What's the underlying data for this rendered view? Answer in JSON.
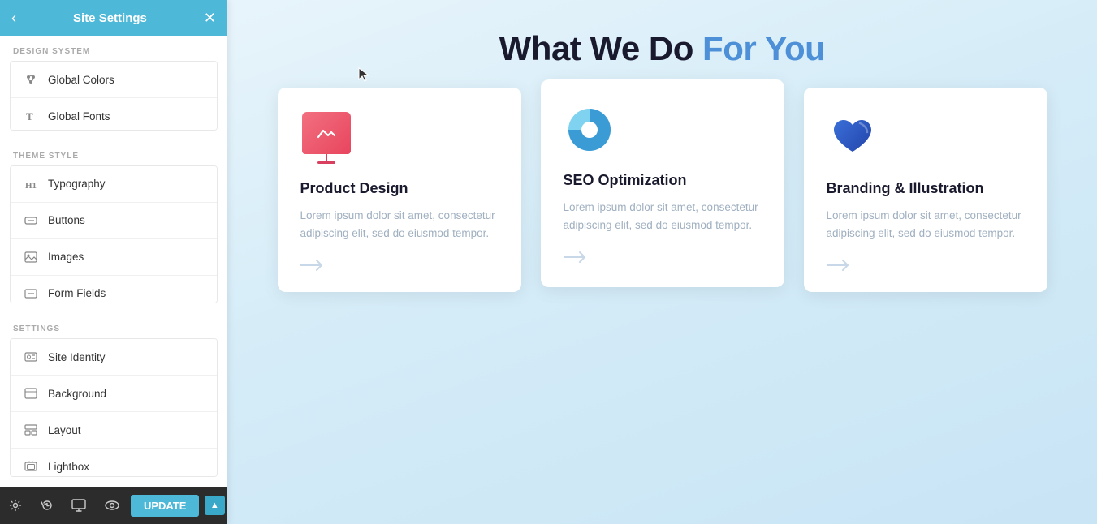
{
  "sidebar": {
    "title": "Site Settings",
    "back_label": "‹",
    "close_label": "✕",
    "sections": [
      {
        "label": "DESIGN SYSTEM",
        "items": [
          {
            "id": "global-colors",
            "label": "Global Colors",
            "icon": "palette"
          },
          {
            "id": "global-fonts",
            "label": "Global Fonts",
            "icon": "font"
          }
        ]
      },
      {
        "label": "THEME STYLE",
        "items": [
          {
            "id": "typography",
            "label": "Typography",
            "icon": "heading"
          },
          {
            "id": "buttons",
            "label": "Buttons",
            "icon": "button"
          },
          {
            "id": "images",
            "label": "Images",
            "icon": "image"
          },
          {
            "id": "form-fields",
            "label": "Form Fields",
            "icon": "form"
          }
        ]
      },
      {
        "label": "SETTINGS",
        "items": [
          {
            "id": "site-identity",
            "label": "Site Identity",
            "icon": "id"
          },
          {
            "id": "background",
            "label": "Background",
            "icon": "bg"
          },
          {
            "id": "layout",
            "label": "Layout",
            "icon": "layout"
          },
          {
            "id": "lightbox",
            "label": "Lightbox",
            "icon": "lightbox"
          }
        ]
      }
    ],
    "bottom": {
      "update_label": "UPDATE",
      "icons": [
        "gear",
        "history",
        "desktop",
        "eye"
      ]
    }
  },
  "main": {
    "title_part1": "What We Do ",
    "title_part2": "For You",
    "accent_color": "#4d90d8",
    "cards": [
      {
        "id": "product-design",
        "icon_type": "board",
        "title": "Product Design",
        "text": "Lorem ipsum dolor sit amet, consectetur adipiscing elit, sed do eiusmod tempor.",
        "arrow": "→"
      },
      {
        "id": "seo-optimization",
        "icon_type": "pie",
        "title": "SEO Optimization",
        "text": "Lorem ipsum dolor sit amet, consectetur adipiscing elit, sed do eiusmod tempor.",
        "arrow": "→"
      },
      {
        "id": "branding-illustration",
        "icon_type": "heart",
        "title": "Branding & Illustration",
        "text": "Lorem ipsum dolor sit amet, consectetur adipiscing elit, sed do eiusmod tempor.",
        "arrow": "→"
      }
    ]
  }
}
